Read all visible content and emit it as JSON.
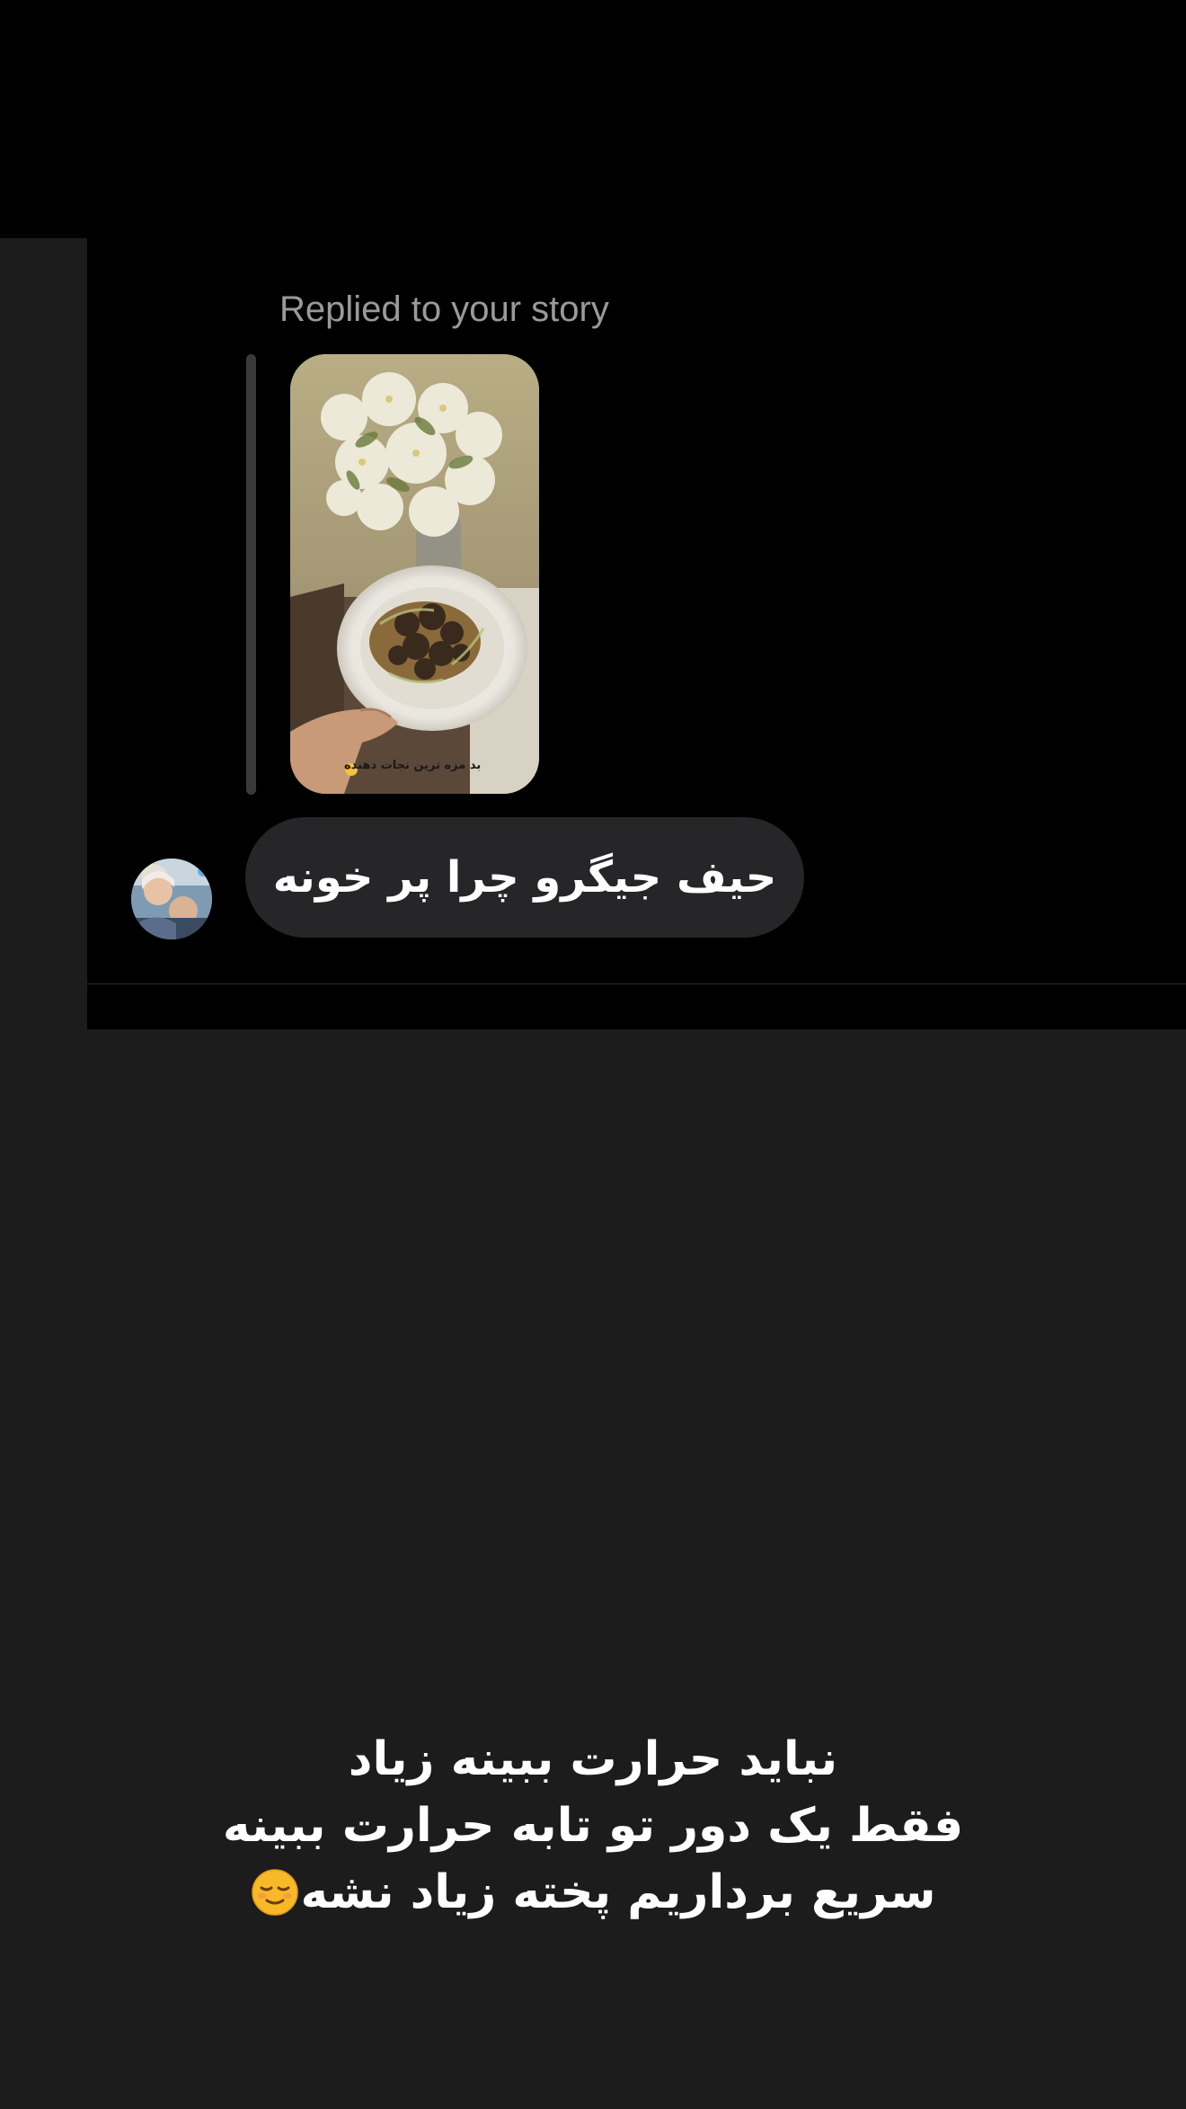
{
  "dm": {
    "replied_label": "Replied to your story",
    "story": {
      "caption": "بد مزه ترین نجات دهنده"
    },
    "message": "حیف جیگرو چرا پر خونه"
  },
  "story_text": {
    "line1": "نباید حرارت ببینه زیاد",
    "line2": "فقط یک دور تو تابه حرارت ببینه",
    "line3": "سریع برداریم پخته زیاد نشه",
    "emoji": "relieved-face-icon"
  }
}
